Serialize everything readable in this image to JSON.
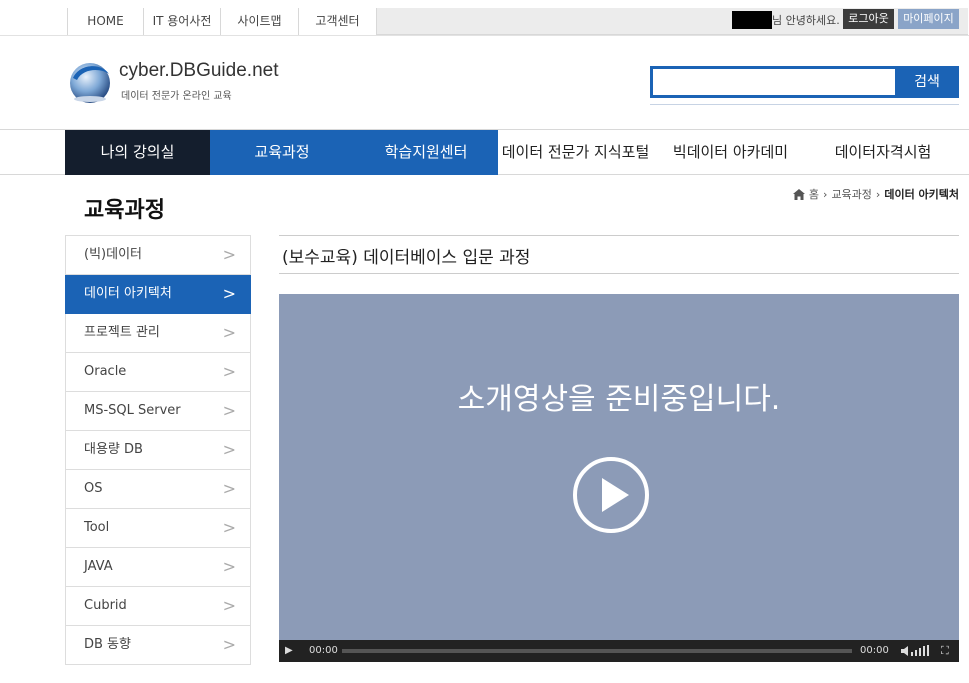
{
  "topbar": {
    "links": [
      {
        "label": "HOME"
      },
      {
        "label": "IT 용어사전"
      },
      {
        "label": "사이트맵"
      },
      {
        "label": "고객센터"
      }
    ],
    "greeting": "님 안녕하세요.",
    "logout_label": "로그아웃",
    "mypage_label": "마이페이지"
  },
  "header": {
    "logo_title": "cyber.DBGuide.net",
    "logo_sub": "데이터 전문가 온라인 교육",
    "search_placeholder": "",
    "search_label": "검색"
  },
  "nav": {
    "items": [
      {
        "label": "나의 강의실"
      },
      {
        "label": "교육과정"
      },
      {
        "label": "학습지원센터"
      },
      {
        "label": "데이터 전문가 지식포털"
      },
      {
        "label": "빅데이터 아카데미"
      },
      {
        "label": "데이터자격시험"
      }
    ]
  },
  "page": {
    "title": "교육과정",
    "breadcrumb": {
      "home": "홈",
      "level1": "교육과정",
      "current": "데이터 아키텍처"
    }
  },
  "sidebar": {
    "items": [
      {
        "label": "(빅)데이터"
      },
      {
        "label": "데이터 아키텍처"
      },
      {
        "label": "프로젝트 관리"
      },
      {
        "label": "Oracle"
      },
      {
        "label": "MS-SQL Server"
      },
      {
        "label": "대용량 DB"
      },
      {
        "label": "OS"
      },
      {
        "label": "Tool"
      },
      {
        "label": "JAVA"
      },
      {
        "label": "Cubrid"
      },
      {
        "label": "DB 동향"
      }
    ]
  },
  "course": {
    "title": "(보수교육) 데이터베이스 입문 과정",
    "video_message": "소개영상을 준비중입니다.",
    "time_current": "00:00",
    "time_total": "00:00"
  },
  "colors": {
    "primary": "#1b63b5",
    "nav_dark": "#141e2d",
    "video_bg": "#8c9bb7"
  }
}
